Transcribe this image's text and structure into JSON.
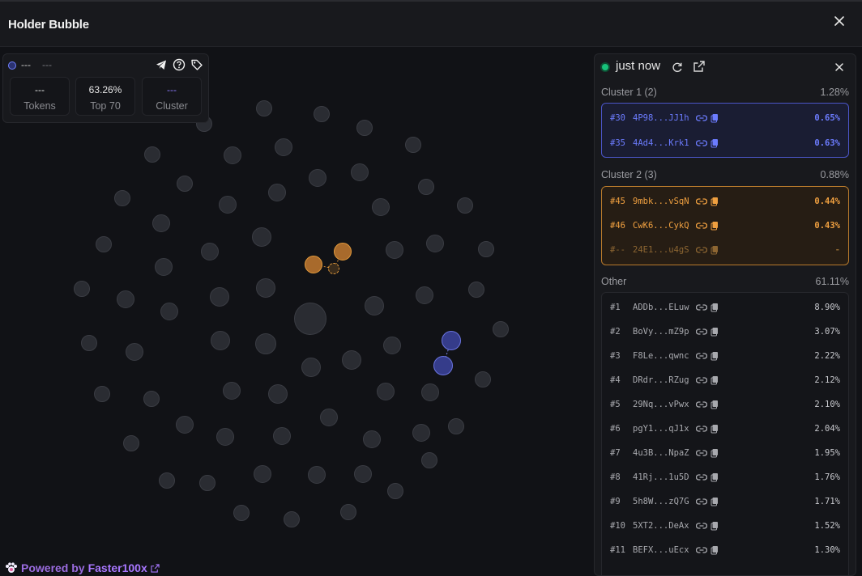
{
  "header": {
    "title": "Holder Bubble"
  },
  "info": {
    "name": "---",
    "symbol": "---",
    "stats": [
      {
        "value": "---",
        "label": "Tokens"
      },
      {
        "value": "63.26%",
        "label": "Top 70"
      },
      {
        "value": "---",
        "label": "Cluster"
      }
    ]
  },
  "panel": {
    "status": "just now",
    "clusters": [
      {
        "title": "Cluster 1 (2)",
        "pct": "1.28%",
        "rows": [
          {
            "rank": "#30",
            "addr": "4P98...JJ1h",
            "pct": "0.65%"
          },
          {
            "rank": "#35",
            "addr": "4Ad4...Krk1",
            "pct": "0.63%"
          }
        ]
      },
      {
        "title": "Cluster 2 (3)",
        "pct": "0.88%",
        "rows": [
          {
            "rank": "#45",
            "addr": "9mbk...vSqN",
            "pct": "0.44%"
          },
          {
            "rank": "#46",
            "addr": "CwK6...CykQ",
            "pct": "0.43%"
          },
          {
            "rank": "#--",
            "addr": "24E1...u4gS",
            "pct": "-"
          }
        ]
      }
    ],
    "other": {
      "title": "Other",
      "pct": "61.11%",
      "rows": [
        {
          "rank": "#1",
          "addr": "ADDb...ELuw",
          "pct": "8.90%"
        },
        {
          "rank": "#2",
          "addr": "BoVy...mZ9p",
          "pct": "3.07%"
        },
        {
          "rank": "#3",
          "addr": "F8Le...qwnc",
          "pct": "2.22%"
        },
        {
          "rank": "#4",
          "addr": "DRdr...RZug",
          "pct": "2.12%"
        },
        {
          "rank": "#5",
          "addr": "29Nq...vPwx",
          "pct": "2.10%"
        },
        {
          "rank": "#6",
          "addr": "pgY1...qJ1x",
          "pct": "2.04%"
        },
        {
          "rank": "#7",
          "addr": "4u3B...NpaZ",
          "pct": "1.95%"
        },
        {
          "rank": "#8",
          "addr": "41Rj...1u5D",
          "pct": "1.76%"
        },
        {
          "rank": "#9",
          "addr": "5h8W...zQ7G",
          "pct": "1.71%"
        },
        {
          "rank": "#10",
          "addr": "5XT2...DeAx",
          "pct": "1.52%"
        },
        {
          "rank": "#11",
          "addr": "BEFX...uEcx",
          "pct": "1.30%"
        }
      ]
    }
  },
  "footer": {
    "powered_by": "Powered by",
    "brand": "Faster100x"
  },
  "colors": {
    "cluster1": "#6c7cff",
    "cluster2": "#f0a040",
    "accent": "#a877ff",
    "online": "#17c27a"
  },
  "icons": [
    "close-icon",
    "telegram-icon",
    "help-icon",
    "tag-icon",
    "refresh-icon",
    "external-link-icon",
    "link-icon",
    "copy-icon",
    "paw-icon"
  ]
}
